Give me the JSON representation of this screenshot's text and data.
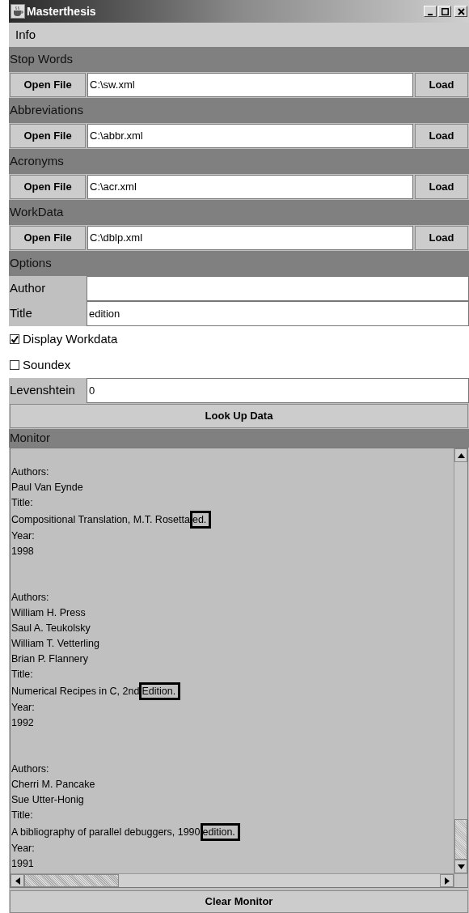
{
  "window": {
    "title": "Masterthesis"
  },
  "menu": [
    {
      "label": "Info"
    }
  ],
  "file_sections": [
    {
      "header": "Stop Words",
      "open_button": "Open File",
      "path": "C:\\sw.xml",
      "load_button": "Load"
    },
    {
      "header": "Abbreviations",
      "open_button": "Open File",
      "path": "C:\\abbr.xml",
      "load_button": "Load"
    },
    {
      "header": "Acronyms",
      "open_button": "Open File",
      "path": "C:\\acr.xml",
      "load_button": "Load"
    },
    {
      "header": "WorkData",
      "open_button": "Open File",
      "path": "C:\\dblp.xml",
      "load_button": "Load"
    }
  ],
  "options": {
    "header": "Options",
    "fields": [
      {
        "label": "Author"
      },
      {
        "label": "Title",
        "value": "edition"
      }
    ],
    "checkboxes": [
      {
        "label": "Display Workdata",
        "checked": true
      },
      {
        "label": "Soundex",
        "checked": false
      }
    ],
    "levenshtein": {
      "label": "Levenshtein",
      "value": "0"
    },
    "lookup_button": "Look Up Data"
  },
  "monitor": {
    "header": "Monitor",
    "entries": [
      {
        "authors_label": "Authors:",
        "authors": [
          "Paul Van Eynde"
        ],
        "title_label": "Title:",
        "title": "Compositional Translation, M.T. Rosetta",
        "match": "ed.",
        "year_label": "Year:",
        "year": "1998"
      },
      {
        "authors_label": "Authors:",
        "authors": [
          "William H. Press",
          "Saul A. Teukolsky",
          "William T. Vetterling",
          "Brian P. Flannery"
        ],
        "title_label": "Title:",
        "title": "Numerical Recipes in C, 2nd",
        "match": "Edition.",
        "year_label": "Year:",
        "year": "1992"
      },
      {
        "authors_label": "Authors:",
        "authors": [
          "Cherri M. Pancake",
          "Sue Utter-Honig"
        ],
        "title_label": "Title:",
        "title": "A bibliography of parallel debuggers, 1990",
        "match": "edition.",
        "year_label": "Year:",
        "year": "1991"
      }
    ],
    "clear_button": "Clear Monitor"
  }
}
